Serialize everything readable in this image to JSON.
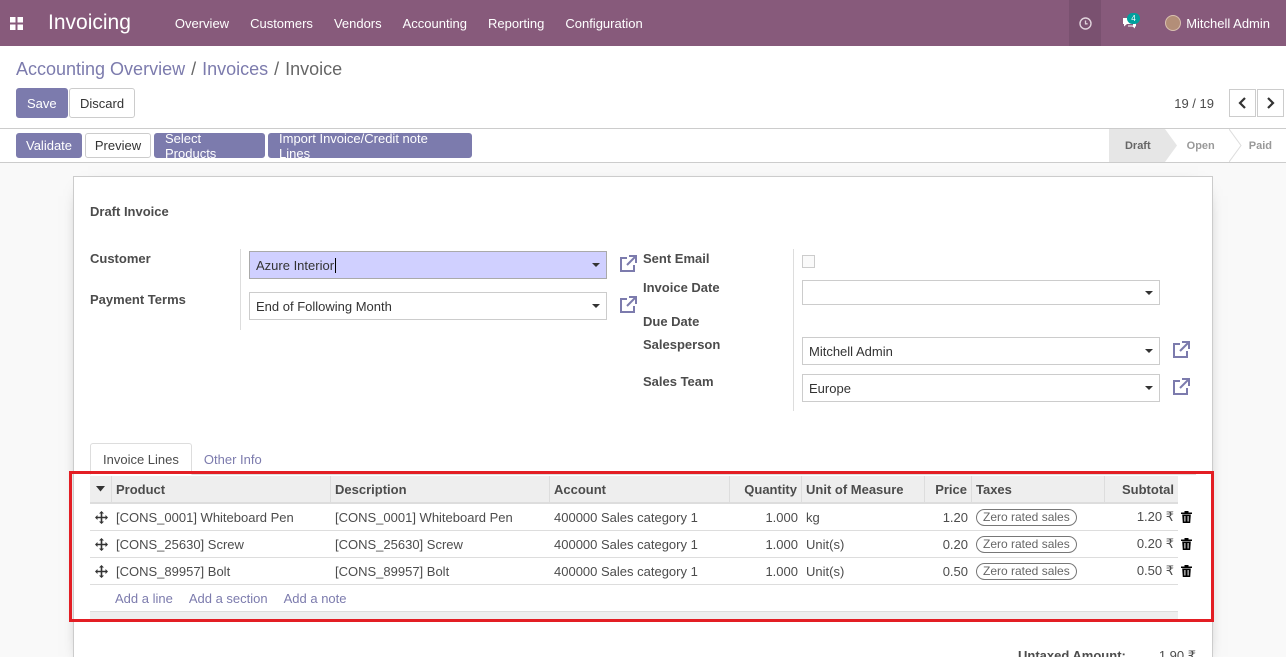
{
  "navbar": {
    "app_title": "Invoicing",
    "menu": [
      "Overview",
      "Customers",
      "Vendors",
      "Accounting",
      "Reporting",
      "Configuration"
    ],
    "chat_count": "4",
    "user_name": "Mitchell Admin"
  },
  "breadcrumb": {
    "items": [
      "Accounting Overview",
      "Invoices"
    ],
    "current": "Invoice",
    "sep": "/"
  },
  "actions": {
    "save": "Save",
    "discard": "Discard"
  },
  "pager": {
    "value": "19 / 19"
  },
  "statusbar": {
    "buttons": [
      "Validate",
      "Preview",
      "Select Products",
      "Import Invoice/Credit note Lines"
    ],
    "states": [
      "Draft",
      "Open",
      "Paid"
    ],
    "active_state": "Draft"
  },
  "form": {
    "title": "Draft Invoice",
    "customer_label": "Customer",
    "customer_value": "Azure Interior",
    "payment_terms_label": "Payment Terms",
    "payment_terms_value": "End of Following Month",
    "sent_email_label": "Sent Email",
    "invoice_date_label": "Invoice Date",
    "invoice_date_value": "",
    "due_date_label": "Due Date",
    "salesperson_label": "Salesperson",
    "salesperson_value": "Mitchell Admin",
    "sales_team_label": "Sales Team",
    "sales_team_value": "Europe"
  },
  "tabs": [
    "Invoice Lines",
    "Other Info"
  ],
  "table": {
    "columns": [
      "Product",
      "Description",
      "Account",
      "Quantity",
      "Unit of Measure",
      "Price",
      "Taxes",
      "Subtotal"
    ],
    "rows": [
      {
        "product": "[CONS_0001] Whiteboard Pen",
        "description": "[CONS_0001] Whiteboard Pen",
        "account": "400000 Sales category 1",
        "quantity": "1.000",
        "uom": "kg",
        "price": "1.20",
        "taxes": "Zero rated sales",
        "subtotal": "1.20 ₹"
      },
      {
        "product": "[CONS_25630] Screw",
        "description": "[CONS_25630] Screw",
        "account": "400000 Sales category 1",
        "quantity": "1.000",
        "uom": "Unit(s)",
        "price": "0.20",
        "taxes": "Zero rated sales",
        "subtotal": "0.20 ₹"
      },
      {
        "product": "[CONS_89957] Bolt",
        "description": "[CONS_89957] Bolt",
        "account": "400000 Sales category 1",
        "quantity": "1.000",
        "uom": "Unit(s)",
        "price": "0.50",
        "taxes": "Zero rated sales",
        "subtotal": "0.50 ₹"
      }
    ],
    "add_links": [
      "Add a line",
      "Add a section",
      "Add a note"
    ]
  },
  "totals": {
    "untaxed_label": "Untaxed Amount:",
    "untaxed_value": "1.90 ₹"
  },
  "colors": {
    "navbar": "#875a7b",
    "primary": "#7c7bad",
    "highlight": "#e31e24"
  }
}
